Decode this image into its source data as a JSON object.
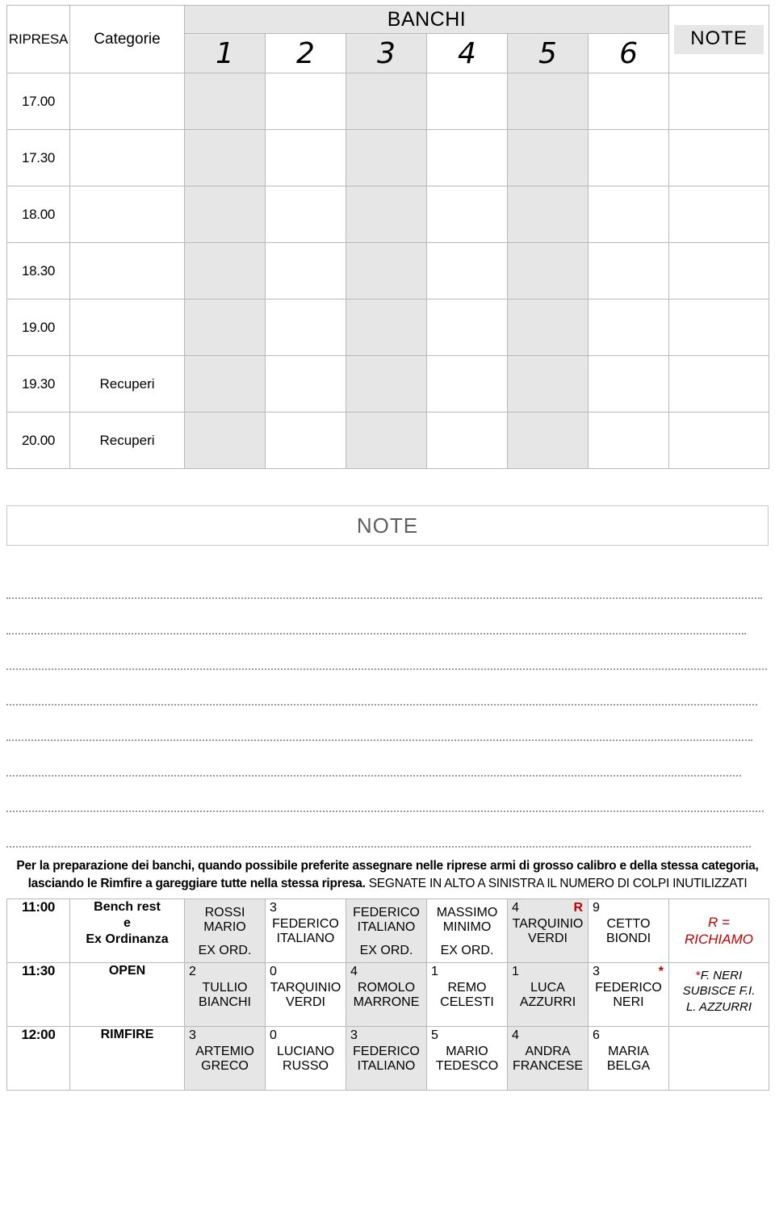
{
  "schedule_table": {
    "headers": {
      "ripresa": "RIPRESA",
      "categorie": "Categorie",
      "banchi": "BANCHI",
      "note": "NOTE",
      "bench_numbers": [
        "1",
        "2",
        "3",
        "4",
        "5",
        "6"
      ]
    },
    "rows": [
      {
        "time": "17.00",
        "categoria": "",
        "benches": [
          "",
          "",
          "",
          "",
          "",
          ""
        ],
        "note": ""
      },
      {
        "time": "17.30",
        "categoria": "",
        "benches": [
          "",
          "",
          "",
          "",
          "",
          ""
        ],
        "note": ""
      },
      {
        "time": "18.00",
        "categoria": "",
        "benches": [
          "",
          "",
          "",
          "",
          "",
          ""
        ],
        "note": ""
      },
      {
        "time": "18.30",
        "categoria": "",
        "benches": [
          "",
          "",
          "",
          "",
          "",
          ""
        ],
        "note": ""
      },
      {
        "time": "19.00",
        "categoria": "",
        "benches": [
          "",
          "",
          "",
          "",
          "",
          ""
        ],
        "note": ""
      },
      {
        "time": "19.30",
        "categoria": "Recuperi",
        "benches": [
          "",
          "",
          "",
          "",
          "",
          ""
        ],
        "note": ""
      },
      {
        "time": "20.00",
        "categoria": "Recuperi",
        "benches": [
          "",
          "",
          "",
          "",
          "",
          ""
        ],
        "note": ""
      }
    ]
  },
  "note_box": {
    "label": "NOTE",
    "blank_lines": 8
  },
  "instructions": {
    "line1": "Per la preparazione dei banchi, quando possibile preferite assegnare nelle riprese armi di grosso calibro e della stessa categoria,",
    "line2_part1": "lasciando le Rimfire a gareggiare tutte nella stessa ripresa. ",
    "line2_part2": "SEGNATE IN ALTO A SINISTRA IL NUMERO DI COLPI INUTILIZZATI"
  },
  "assignment_table": {
    "rows": [
      {
        "time": "11:00",
        "categoria": "Bench rest\ne\nEx Ordinanza",
        "categoria_lines": [
          "Bench rest",
          "e",
          "Ex Ordinanza"
        ],
        "slots": [
          {
            "corner": "",
            "corner_right": "",
            "name": "ROSSI\nMARIO",
            "name_lines": [
              "ROSSI",
              "MARIO"
            ],
            "sub": "EX ORD."
          },
          {
            "corner": "3",
            "corner_right": "",
            "name": "FEDERICO\nITALIANO",
            "name_lines": [
              "FEDERICO",
              "ITALIANO"
            ],
            "sub": ""
          },
          {
            "corner": "",
            "corner_right": "",
            "name": "FEDERICO\nITALIANO",
            "name_lines": [
              "FEDERICO",
              "ITALIANO"
            ],
            "sub": "EX ORD."
          },
          {
            "corner": "",
            "corner_right": "",
            "name": "MASSIMO\nMINIMO",
            "name_lines": [
              "MASSIMO",
              "MINIMO"
            ],
            "sub": "EX ORD."
          },
          {
            "corner": "4",
            "corner_right": "R",
            "name": "TARQUINIO\nVERDI",
            "name_lines": [
              "TARQUINIO",
              "VERDI"
            ],
            "sub": ""
          },
          {
            "corner": "9",
            "corner_right": "",
            "name": "CETTO\nBIONDI",
            "name_lines": [
              "CETTO",
              "BIONDI"
            ],
            "sub": ""
          }
        ],
        "legend": {
          "type": "red",
          "lines": [
            "R =",
            "RICHIAMO"
          ]
        }
      },
      {
        "time": "11:30",
        "categoria": "OPEN",
        "categoria_lines": [
          "OPEN"
        ],
        "slots": [
          {
            "corner": "2",
            "corner_right": "",
            "name": "TULLIO\nBIANCHI",
            "name_lines": [
              "TULLIO",
              "BIANCHI"
            ],
            "sub": ""
          },
          {
            "corner": "0",
            "corner_right": "",
            "name": "TARQUINIO\nVERDI",
            "name_lines": [
              "TARQUINIO",
              "VERDI"
            ],
            "sub": ""
          },
          {
            "corner": "4",
            "corner_right": "",
            "name": "ROMOLO\nMARRONE",
            "name_lines": [
              "ROMOLO",
              "MARRONE"
            ],
            "sub": ""
          },
          {
            "corner": "1",
            "corner_right": "",
            "name": "REMO\nCELESTI",
            "name_lines": [
              "REMO",
              "CELESTI"
            ],
            "sub": ""
          },
          {
            "corner": "1",
            "corner_right": "",
            "name": "LUCA\nAZZURRI",
            "name_lines": [
              "LUCA",
              "AZZURRI"
            ],
            "sub": ""
          },
          {
            "corner": "3",
            "corner_right": "*",
            "name": "FEDERICO\nNERI",
            "name_lines": [
              "FEDERICO",
              "NERI"
            ],
            "sub": ""
          }
        ],
        "legend": {
          "type": "star",
          "star": "*",
          "lines": [
            "F. NERI",
            "SUBISCE  F.I.",
            "L. AZZURRI"
          ]
        }
      },
      {
        "time": "12:00",
        "categoria": "RIMFIRE",
        "categoria_lines": [
          "RIMFIRE"
        ],
        "slots": [
          {
            "corner": "3",
            "corner_right": "",
            "name": "ARTEMIO\nGRECO",
            "name_lines": [
              "ARTEMIO",
              "GRECO"
            ],
            "sub": ""
          },
          {
            "corner": "0",
            "corner_right": "",
            "name": "LUCIANO\nRUSSO",
            "name_lines": [
              "LUCIANO",
              "RUSSO"
            ],
            "sub": ""
          },
          {
            "corner": "3",
            "corner_right": "",
            "name": "FEDERICO\nITALIANO",
            "name_lines": [
              "FEDERICO",
              "ITALIANO"
            ],
            "sub": ""
          },
          {
            "corner": "5",
            "corner_right": "",
            "name": "MARIO\nTEDESCO",
            "name_lines": [
              "MARIO",
              "TEDESCO"
            ],
            "sub": ""
          },
          {
            "corner": "4",
            "corner_right": "",
            "name": "ANDRA\nFRANCESE",
            "name_lines": [
              "ANDRA",
              "FRANCESE"
            ],
            "sub": ""
          },
          {
            "corner": "6",
            "corner_right": "",
            "name": "MARIA\nBELGA",
            "name_lines": [
              "MARIA",
              "BELGA"
            ],
            "sub": ""
          }
        ],
        "legend": {
          "type": "none",
          "lines": []
        }
      }
    ]
  },
  "colors": {
    "shade": "#e6e6e6",
    "border": "#b9b9b9",
    "red": "#c00000",
    "note_label": "#5f5f5f"
  }
}
